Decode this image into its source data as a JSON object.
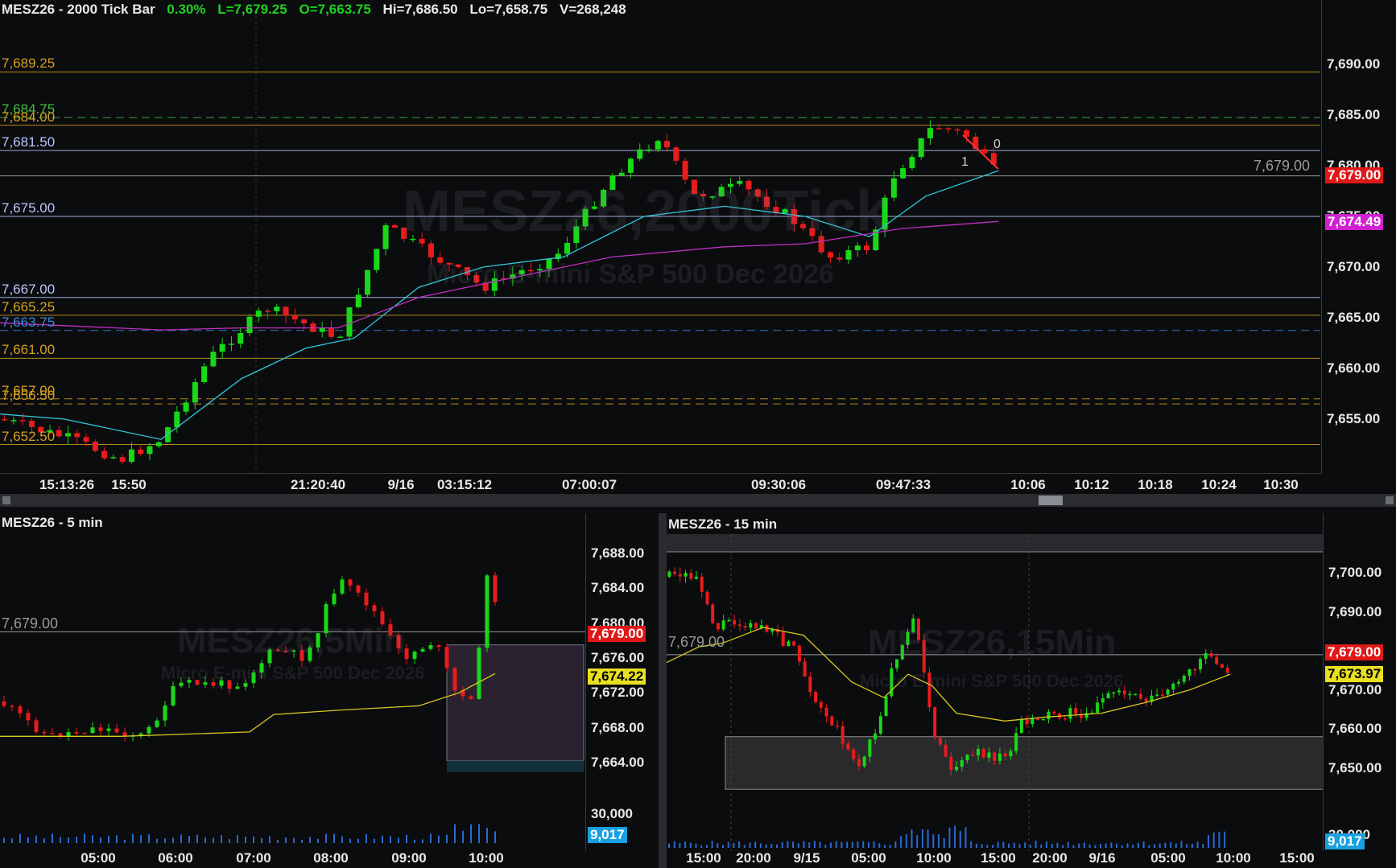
{
  "main": {
    "symbol": "MESZ26 - 2000 Tick Bar",
    "change": "0.30%",
    "last": "L=7,679.25",
    "open": "O=7,663.75",
    "high": "Hi=7,686.50",
    "low": "Lo=7,658.75",
    "volume": "V=268,248",
    "watermark_title": "MESZ26,2000Tick",
    "watermark_sub": "Micro E-mini S&P 500 Dec 2026",
    "y_ticks": [
      "7,690.00",
      "7,685.00",
      "7,680.00",
      "7,675.00",
      "7,670.00",
      "7,665.00",
      "7,660.00",
      "7,655.00"
    ],
    "x_ticks": [
      "15:13:26",
      "15:50",
      "21:20:40",
      "9/16",
      "03:15:12",
      "07:00:07",
      "09:30:06",
      "09:47:33",
      "10:06",
      "10:12",
      "10:18",
      "10:24",
      "10:30"
    ],
    "levels": [
      {
        "label": "7,689.25",
        "color": "#d4a020"
      },
      {
        "label": "7,684.75",
        "color": "#40c040"
      },
      {
        "label": "7,684.00",
        "color": "#d4a020"
      },
      {
        "label": "7,681.50",
        "color": "#b8c8ff"
      },
      {
        "label": "7,675.00",
        "color": "#b8c8ff"
      },
      {
        "label": "7,667.00",
        "color": "#b8c8ff"
      },
      {
        "label": "7,665.25",
        "color": "#d4a020"
      },
      {
        "label": "7,663.75",
        "color": "#3a8adf"
      },
      {
        "label": "7,661.00",
        "color": "#d4a020"
      },
      {
        "label": "7,657.00",
        "color": "#d4a020"
      },
      {
        "label": "7,656.50",
        "color": "#d4a020"
      },
      {
        "label": "7,652.50",
        "color": "#d4a020"
      }
    ],
    "price_line_label": "7,679.00",
    "last_price_tag": "7,679.00",
    "ma_tag": "7,674.49",
    "pivot_labels": [
      "0",
      "1"
    ]
  },
  "bottom_left": {
    "title": "MESZ26 - 5 min",
    "watermark_title": "MESZ26,5Min",
    "watermark_sub": "Micro E-mini S&P 500 Dec 2026",
    "y_ticks": [
      "7,688.00",
      "7,684.00",
      "7,680.00",
      "7,676.00",
      "7,672.00",
      "7,668.00",
      "7,664.00"
    ],
    "vol_tick": "30,000",
    "x_ticks": [
      "05:00",
      "06:00",
      "07:00",
      "08:00",
      "09:00",
      "10:00"
    ],
    "price_line_label": "7,679.00",
    "last_price_tag": "7,679.00",
    "ma_tag": "7,674.22",
    "vol_tag": "9,017"
  },
  "bottom_right": {
    "title": "MESZ26 - 15 min",
    "watermark_title": "MESZ26,15Min",
    "watermark_sub": "Micro E-mini S&P 500 Dec 2026",
    "y_ticks": [
      "7,700.00",
      "7,690.00",
      "7,680.00",
      "7,670.00",
      "7,660.00",
      "7,650.00"
    ],
    "vol_tick": "30,000",
    "x_ticks": [
      "15:00",
      "20:00",
      "9/15",
      "05:00",
      "10:00",
      "15:00",
      "20:00",
      "9/16",
      "05:00",
      "10:00",
      "15:00"
    ],
    "price_line_label": "7,679.00",
    "last_price_tag": "7,679.00",
    "ma_tag": "7,673.97",
    "vol_tag": "9,017"
  },
  "colors": {
    "up": "#18d818",
    "down": "#e81c1c",
    "ma_fast": "#30c8d8",
    "ma_slow": "#c030c0",
    "ma_yellow": "#d8c820"
  }
}
